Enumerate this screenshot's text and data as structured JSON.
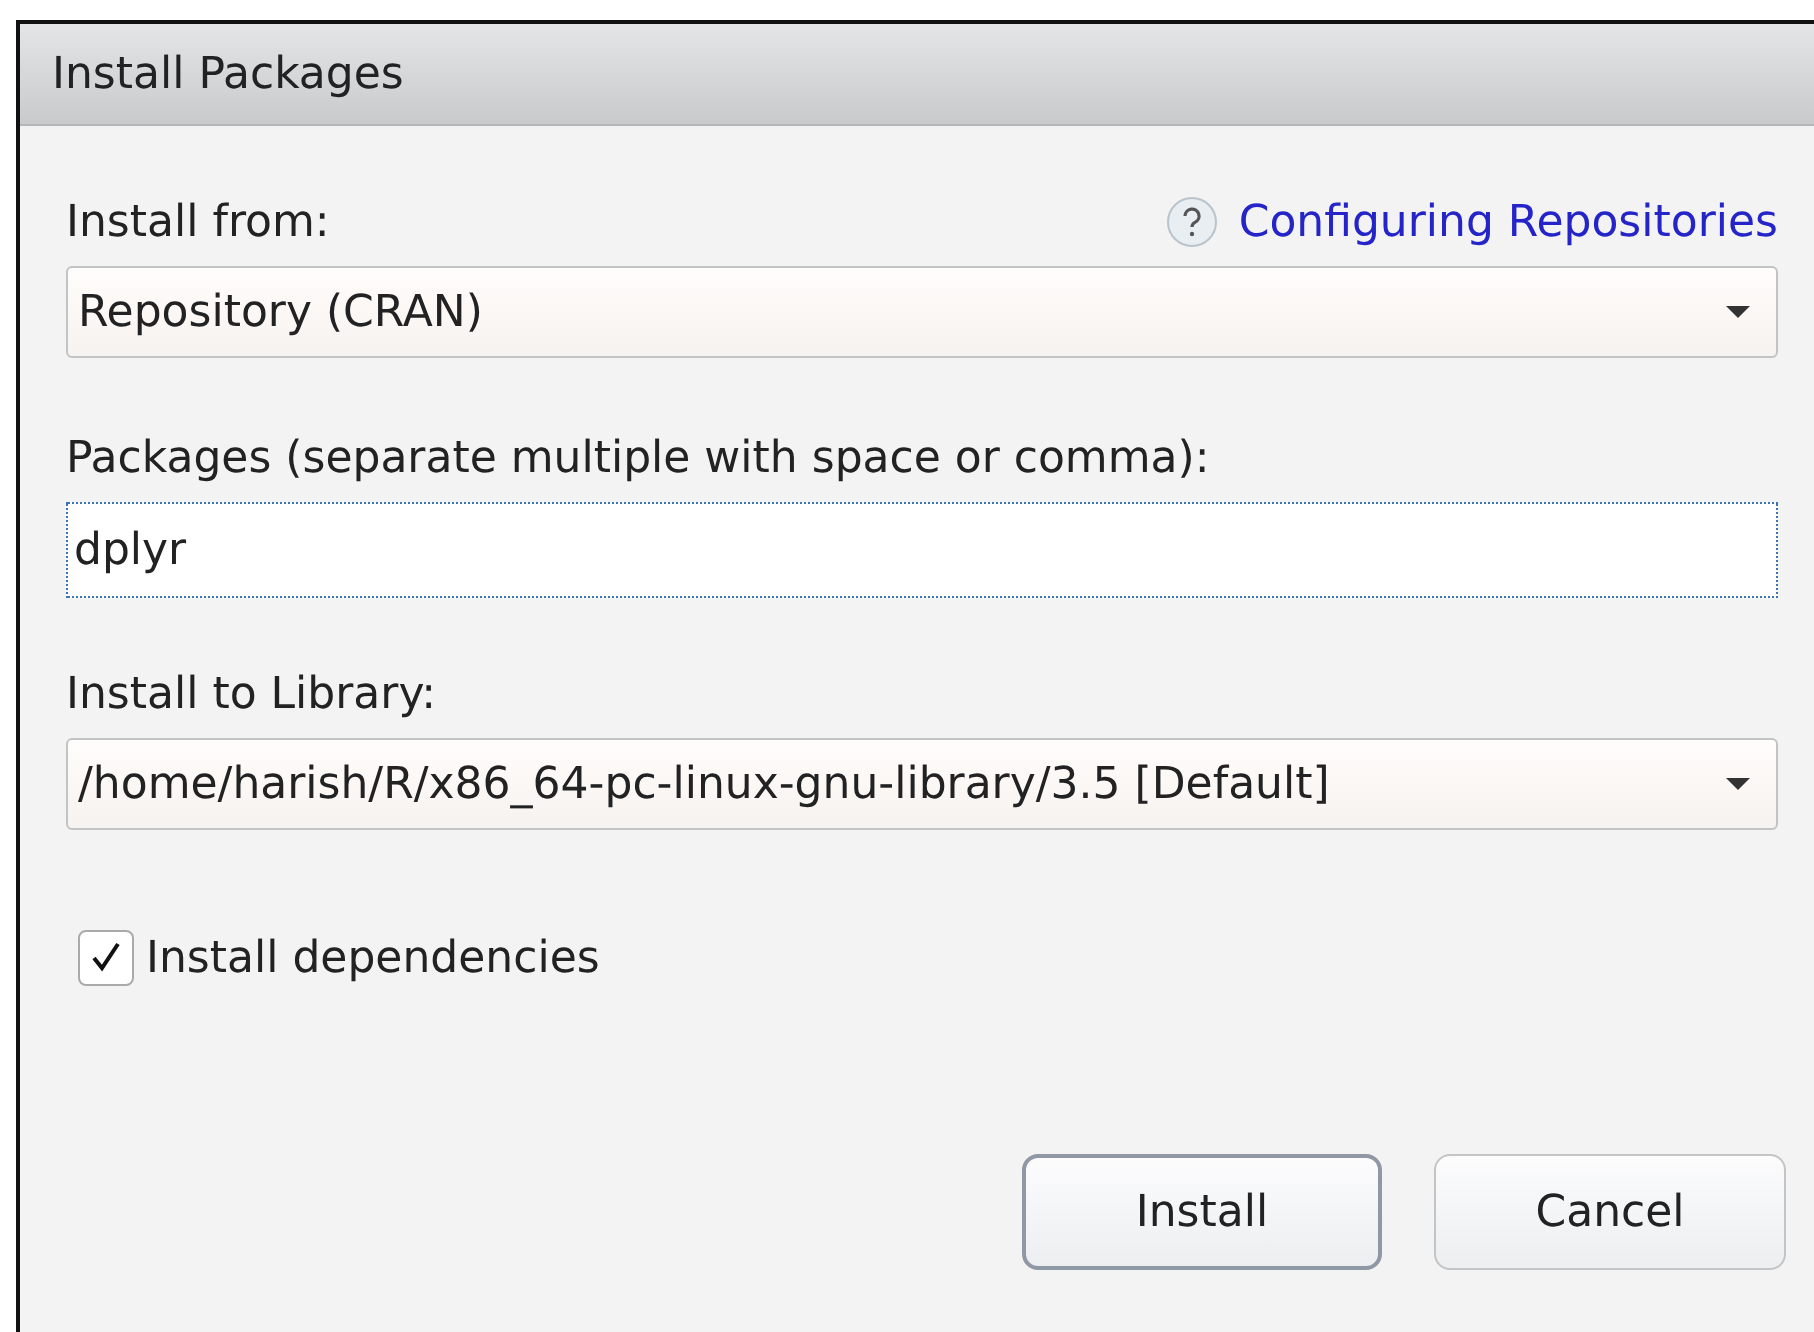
{
  "window": {
    "title": "Install Packages"
  },
  "install_from": {
    "label": "Install from:",
    "help_link": "Configuring Repositories",
    "value": "Repository (CRAN)"
  },
  "packages": {
    "label": "Packages (separate multiple with space or comma):",
    "value": "dplyr"
  },
  "library": {
    "label": "Install to Library:",
    "value": "/home/harish/R/x86_64-pc-linux-gnu-library/3.5 [Default]"
  },
  "dependencies": {
    "label": "Install dependencies",
    "checked": true
  },
  "buttons": [
    {
      "label": "Install",
      "default": true
    },
    {
      "label": "Cancel",
      "default": false
    }
  ]
}
